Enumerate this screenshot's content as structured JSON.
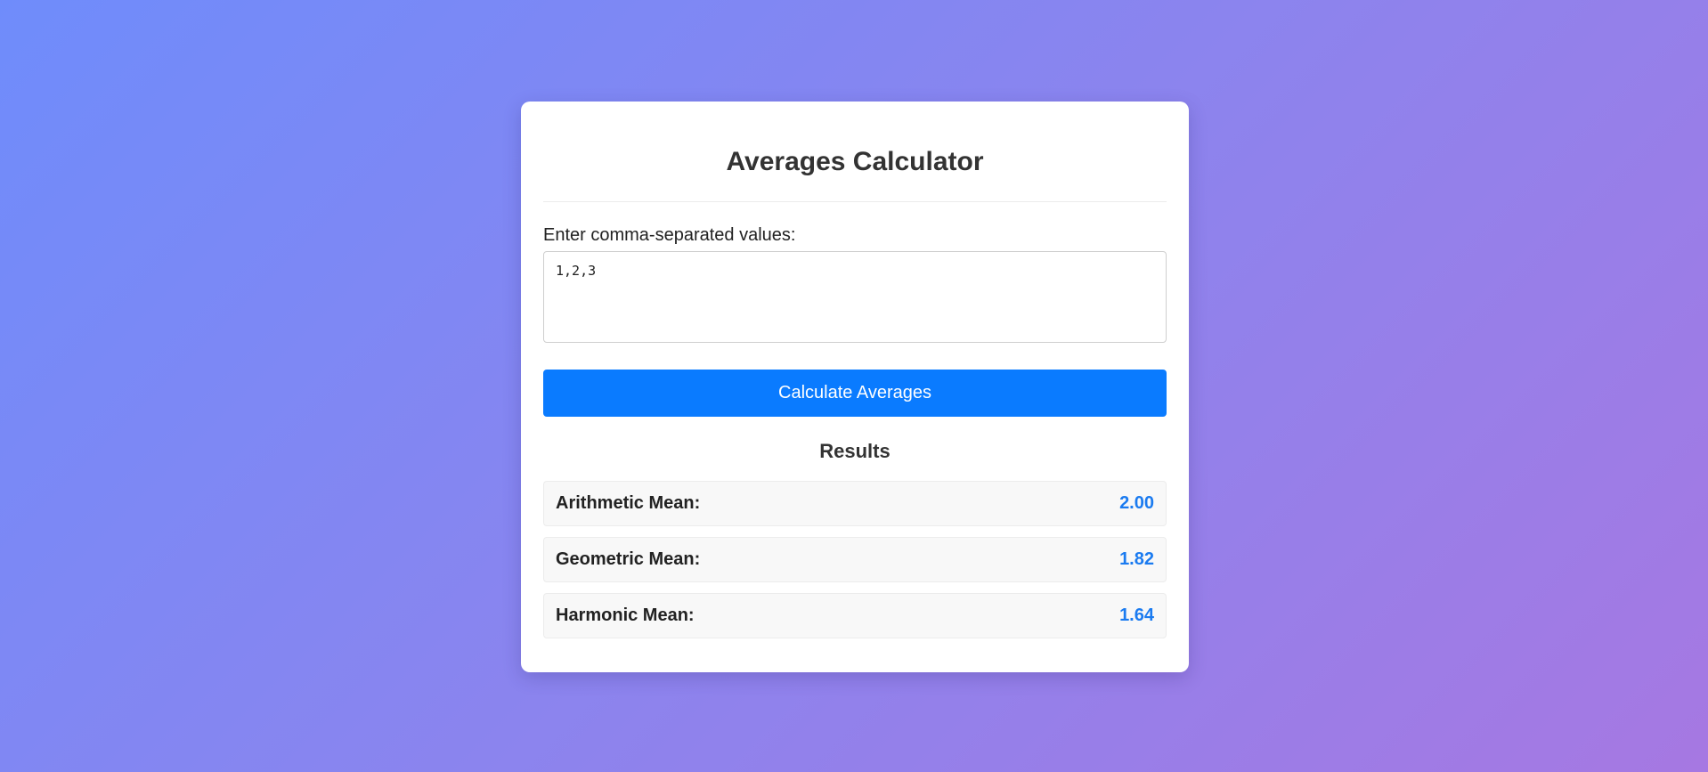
{
  "calculator": {
    "title": "Averages Calculator",
    "input_label": "Enter comma-separated values:",
    "input_value": "1,2,3",
    "button_label": "Calculate Averages"
  },
  "results": {
    "heading": "Results",
    "rows": [
      {
        "label": "Arithmetic Mean:",
        "value": "2.00"
      },
      {
        "label": "Geometric Mean:",
        "value": "1.82"
      },
      {
        "label": "Harmonic Mean:",
        "value": "1.64"
      }
    ]
  },
  "colors": {
    "accent": "#0a7bff",
    "result_value": "#1b7bf0",
    "background_start": "#6f8cfb",
    "background_end": "#a678e2"
  }
}
